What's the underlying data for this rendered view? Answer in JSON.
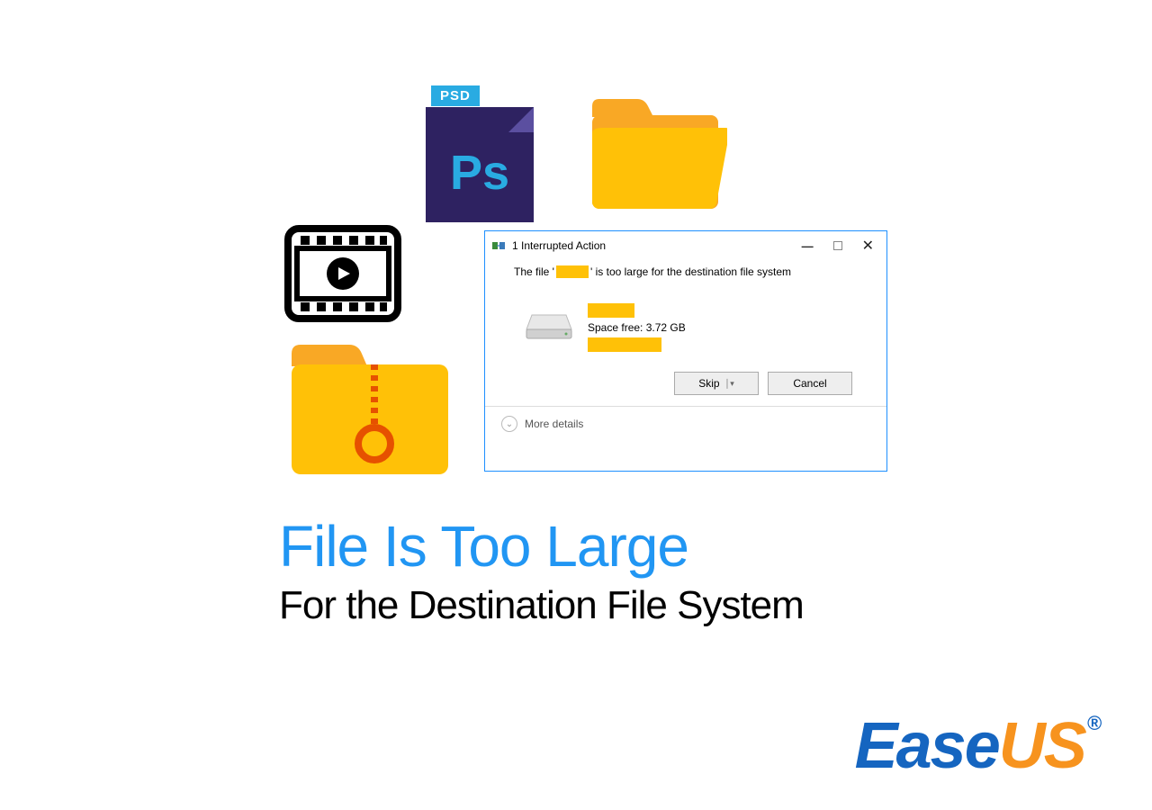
{
  "psd": {
    "badge": "PSD",
    "text": "Ps"
  },
  "dialog": {
    "title": "1 Interrupted Action",
    "message_prefix": "The file '",
    "message_suffix": "' is too large for the destination file system",
    "space_free_label": "Space free:",
    "space_free_value": "3.72 GB",
    "skip_label": "Skip",
    "cancel_label": "Cancel",
    "more_details": "More details"
  },
  "headline": {
    "line1": "File Is Too Large",
    "line2": "For the Destination File System"
  },
  "brand": {
    "part1": "Ease",
    "part2": "US",
    "reg": "®"
  }
}
